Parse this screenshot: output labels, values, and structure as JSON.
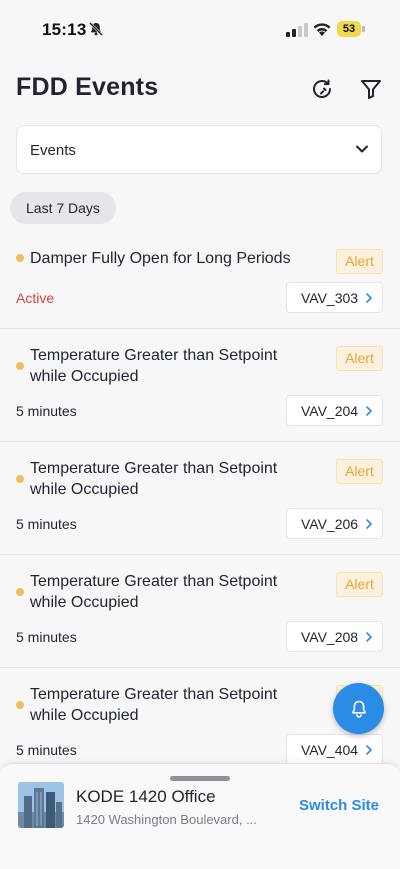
{
  "status_bar": {
    "time": "15:13",
    "battery": "53"
  },
  "header": {
    "title": "FDD Events"
  },
  "dropdown": {
    "value": "Events"
  },
  "filter_chip": {
    "label": "Last 7 Days"
  },
  "events": [
    {
      "title": "Damper Fully Open for Long Periods",
      "badge": "Alert",
      "status": "Active",
      "equipment": "VAV_303"
    },
    {
      "title": "Temperature Greater than Setpoint while Occupied",
      "badge": "Alert",
      "status": "5 minutes",
      "equipment": "VAV_204"
    },
    {
      "title": "Temperature Greater than Setpoint while Occupied",
      "badge": "Alert",
      "status": "5 minutes",
      "equipment": "VAV_206"
    },
    {
      "title": "Temperature Greater than Setpoint while Occupied",
      "badge": "Alert",
      "status": "5 minutes",
      "equipment": "VAV_208"
    },
    {
      "title": "Temperature Greater than Setpoint while Occupied",
      "badge": "Alert",
      "status": "5 minutes",
      "equipment": "VAV_404"
    }
  ],
  "site": {
    "name": "KODE 1420 Office",
    "address": "1420 Washington Boulevard, ...",
    "switch_label": "Switch Site"
  },
  "colors": {
    "accent": "#2b8ce6",
    "alert": "#e8a33a",
    "active": "#d63f3f"
  },
  "icons": {
    "refresh": "refresh-icon",
    "filter": "filter-icon",
    "chevron": "chevron-down-icon",
    "bell": "bell-icon"
  }
}
